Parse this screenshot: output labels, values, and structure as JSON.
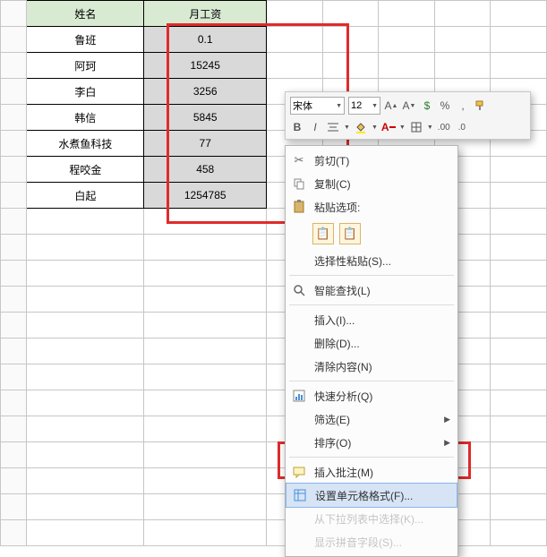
{
  "headers": {
    "name": "姓名",
    "salary": "月工资"
  },
  "rows": [
    {
      "name": "鲁班",
      "salary": "0.1"
    },
    {
      "name": "阿珂",
      "salary": "15245"
    },
    {
      "name": "李白",
      "salary": "3256"
    },
    {
      "name": "韩信",
      "salary": "5845"
    },
    {
      "name": "水煮鱼科技",
      "salary": "77"
    },
    {
      "name": "程咬金",
      "salary": "458"
    },
    {
      "name": "白起",
      "salary": "1254785"
    }
  ],
  "minibar": {
    "font_name": "宋体",
    "font_size": "12",
    "bold": "B",
    "italic": "I",
    "percent": "%",
    "comma": ","
  },
  "ctx": {
    "cut": "剪切(T)",
    "copy": "复制(C)",
    "paste_options": "粘贴选项:",
    "paste_special": "选择性粘贴(S)...",
    "smart_lookup": "智能查找(L)",
    "insert": "插入(I)...",
    "delete": "删除(D)...",
    "clear": "清除内容(N)",
    "quick_analysis": "快速分析(Q)",
    "filter": "筛选(E)",
    "sort": "排序(O)",
    "insert_comment": "插入批注(M)",
    "format_cells": "设置单元格格式(F)...",
    "pick_from_list": "从下拉列表中选择(K)...",
    "show_phonetic": "显示拼音字段(S)..."
  }
}
